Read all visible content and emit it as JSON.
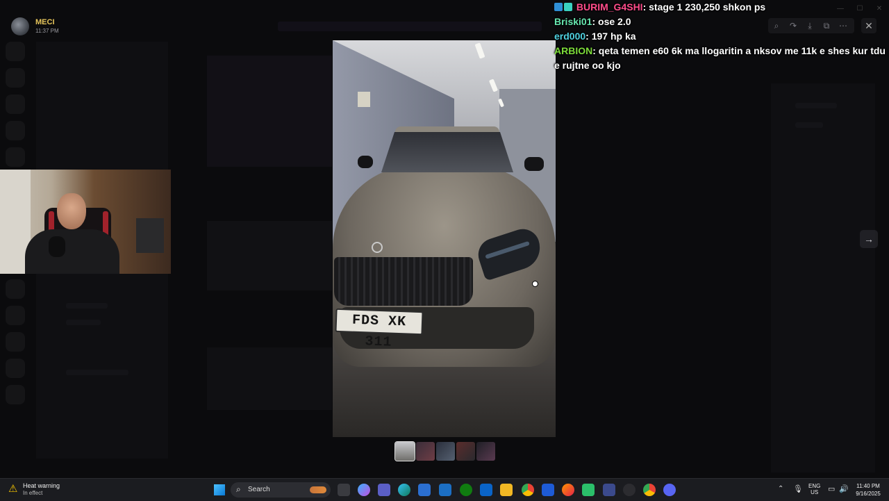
{
  "header": {
    "user_name": "MECI",
    "timestamp": "11:37 PM"
  },
  "plate_text": "FDS XK 311",
  "chat": [
    {
      "user": "BURIM_G4SHI",
      "user_color": "#ff4c8b",
      "message": ": stage 1 230,250 shkon ps",
      "badges": [
        "arrow-badge-icon",
        "teal-badge-icon"
      ]
    },
    {
      "user": "Briski01",
      "user_color": "#67e8b0",
      "message": ": ose 2.0"
    },
    {
      "user": "erd000",
      "user_color": "#4fd1e0",
      "message": ": 197 hp ka"
    },
    {
      "user": "ARBION",
      "user_color": "#7ddc3a",
      "message": ": qeta temen e60 6k ma llogaritin a nksov me 11k e shes kur tdu e rujtne oo kjo"
    }
  ],
  "taskbar": {
    "weather_title": "Heat warning",
    "weather_subtitle": "In effect",
    "search_label": "Search",
    "lang_line1": "ENG",
    "lang_line2": "US",
    "clock_time": "11:40 PM",
    "clock_date": "9/16/2025"
  }
}
